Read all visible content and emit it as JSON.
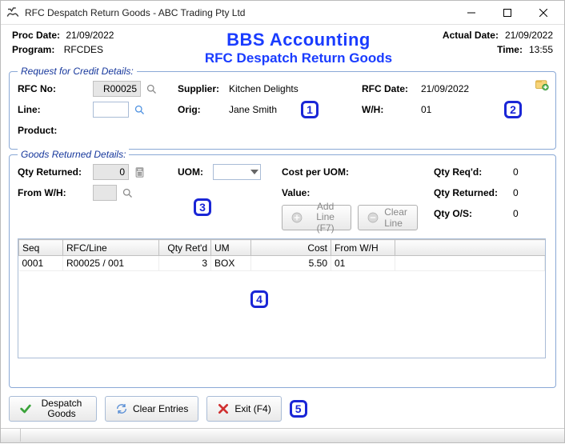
{
  "window": {
    "title": "RFC Despatch Return Goods - ABC Trading Pty Ltd"
  },
  "header": {
    "proc_date_label": "Proc Date:",
    "proc_date_value": "21/09/2022",
    "program_label": "Program:",
    "program_value": "RFCDES",
    "brand_title": "BBS Accounting",
    "brand_subtitle": "RFC Despatch Return Goods",
    "actual_date_label": "Actual Date:",
    "actual_date_value": "21/09/2022",
    "time_label": "Time:",
    "time_value": "13:55"
  },
  "rfc_group": {
    "title": "Request for Credit Details:",
    "rfc_no_label": "RFC No:",
    "rfc_no_value": "R00025",
    "line_label": "Line:",
    "line_value": "",
    "product_label": "Product:",
    "supplier_label": "Supplier:",
    "supplier_value": "Kitchen Delights",
    "orig_label": "Orig:",
    "orig_value": "Jane Smith",
    "rfc_date_label": "RFC Date:",
    "rfc_date_value": "21/09/2022",
    "wh_label": "W/H:",
    "wh_value": "01"
  },
  "goods_group": {
    "title": "Goods Returned Details:",
    "qty_returned_label": "Qty Returned:",
    "qty_returned_value": "0",
    "uom_label": "UOM:",
    "cost_per_uom_label": "Cost per UOM:",
    "value_label": "Value:",
    "from_wh_label": "From W/H:",
    "qty_reqd_label": "Qty Req'd:",
    "qty_reqd_value": "0",
    "qty_returned_r_label": "Qty Returned:",
    "qty_returned_r_value": "0",
    "qty_os_label": "Qty O/S:",
    "qty_os_value": "0",
    "add_line_label": "Add Line (F7)",
    "clear_line_label": "Clear Line"
  },
  "table": {
    "columns": [
      "Seq",
      "RFC/Line",
      "Qty Ret'd",
      "UM",
      "Cost",
      "From W/H"
    ],
    "rows": [
      {
        "seq": "0001",
        "rfc_line": "R00025 / 001",
        "qty": "3",
        "um": "BOX",
        "cost": "5.50",
        "from_wh": "01"
      }
    ]
  },
  "bottom": {
    "despatch_label": "Despatch Goods",
    "clear_entries_label": "Clear Entries",
    "exit_label": "Exit (F4)"
  },
  "annotations": {
    "a1": "1",
    "a2": "2",
    "a3": "3",
    "a4": "4",
    "a5": "5"
  }
}
